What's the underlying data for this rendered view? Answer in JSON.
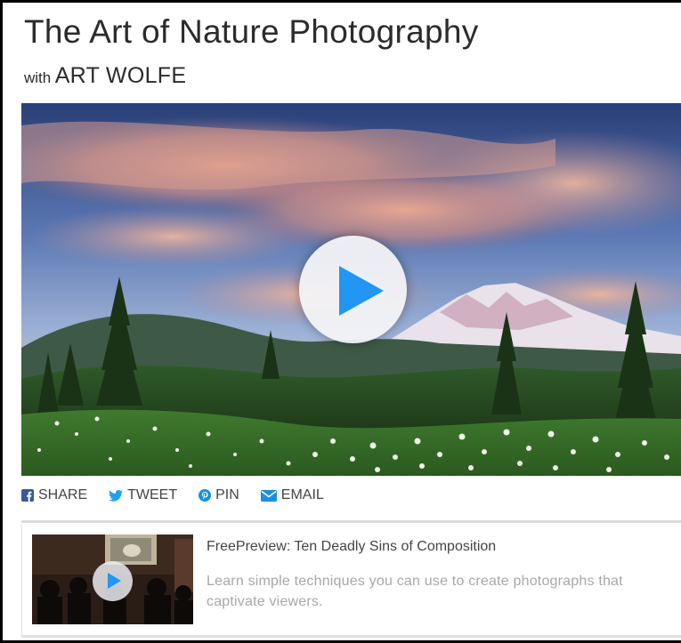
{
  "course": {
    "title": "The Art of Nature Photography",
    "with_prefix": "with",
    "instructor": "ART WOLFE"
  },
  "video": {
    "play_icon": "play-icon",
    "accent_color": "#2196f3"
  },
  "share": {
    "items": [
      {
        "label": "SHARE",
        "icon": "facebook-icon",
        "color": "#3b5998"
      },
      {
        "label": "TWEET",
        "icon": "twitter-icon",
        "color": "#1da1f2"
      },
      {
        "label": "PIN",
        "icon": "pinterest-icon",
        "color": "#1a8fe3"
      },
      {
        "label": "EMAIL",
        "icon": "email-icon",
        "color": "#1a8fe3"
      }
    ]
  },
  "preview": {
    "title": "FreePreview: Ten Deadly Sins of Composition",
    "description": "Learn simple techniques you can use to create photographs that captivate viewers."
  }
}
